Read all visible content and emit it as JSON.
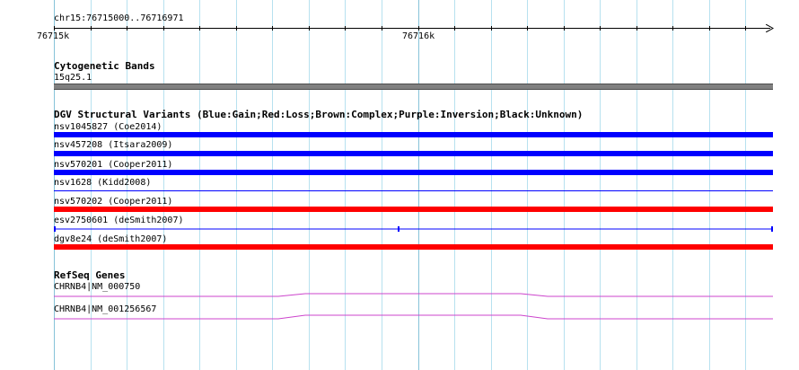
{
  "ruler": {
    "location": "chr15:76715000..76716971",
    "tick_label_start": "76715k",
    "tick_label_mid": "76716k"
  },
  "tracks": {
    "cytoband": {
      "title": "Cytogenetic Bands",
      "band_label": "15q25.1",
      "band_color": "#808080"
    },
    "dgv": {
      "title": "DGV Structural Variants (Blue:Gain;Red:Loss;Brown:Complex;Purple:Inversion;Black:Unknown)",
      "colors": {
        "gain": "#0000ff",
        "loss": "#ff0000"
      },
      "items": [
        {
          "label": "nsv1045827 (Coe2014)",
          "type": "gain",
          "style": "thick"
        },
        {
          "label": "nsv457208 (Itsara2009)",
          "type": "gain",
          "style": "thick"
        },
        {
          "label": "nsv570201 (Cooper2011)",
          "type": "gain",
          "style": "thick"
        },
        {
          "label": "nsv1628 (Kidd2008)",
          "type": "gain",
          "style": "thin"
        },
        {
          "label": "nsv570202 (Cooper2011)",
          "type": "loss",
          "style": "thick"
        },
        {
          "label": "esv2750601 (deSmith2007)",
          "type": "gain",
          "style": "ticked"
        },
        {
          "label": "dgv8e24 (deSmith2007)",
          "type": "loss",
          "style": "thick"
        }
      ]
    },
    "refseq": {
      "title": "RefSeq Genes",
      "gene_color": "#cc44cc",
      "genes": [
        {
          "label": "CHRNB4|NM_000750"
        },
        {
          "label": "CHRNB4|NM_001256567"
        }
      ]
    }
  },
  "colors": {
    "grid": "#b7e1ef",
    "grid_major": "#86c3d8"
  }
}
